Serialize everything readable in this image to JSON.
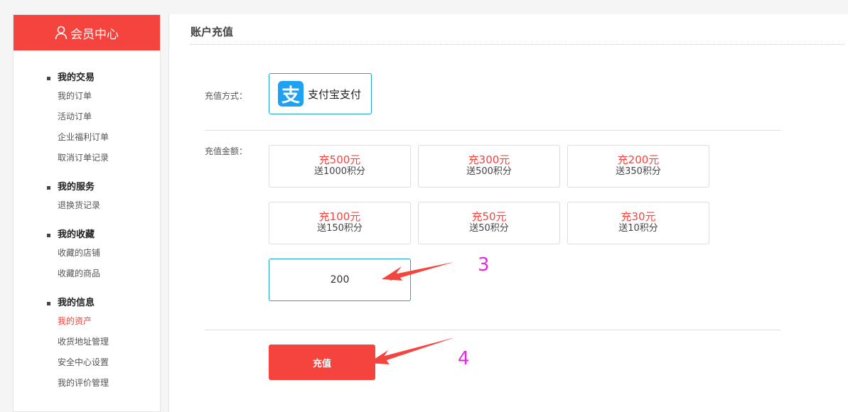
{
  "sidebar": {
    "title": "会员中心",
    "groups": [
      {
        "title": "我的交易",
        "items": [
          "我的订单",
          "活动订单",
          "企业福利订单",
          "取消订单记录"
        ]
      },
      {
        "title": "我的服务",
        "items": [
          "退换货记录"
        ]
      },
      {
        "title": "我的收藏",
        "items": [
          "收藏的店铺",
          "收藏的商品"
        ]
      },
      {
        "title": "我的信息",
        "items": [
          "我的资产",
          "收货地址管理",
          "安全中心设置",
          "我的评价管理"
        ]
      }
    ]
  },
  "main": {
    "title": "账户充值",
    "pay_method_label": "充值方式：",
    "pay_option": "支付宝支付",
    "amount_label": "充值金额：",
    "options": [
      {
        "amount": "充500元",
        "bonus": "送1000积分"
      },
      {
        "amount": "充300元",
        "bonus": "送500积分"
      },
      {
        "amount": "充200元",
        "bonus": "送350积分"
      },
      {
        "amount": "充100元",
        "bonus": "送150积分"
      },
      {
        "amount": "充50元",
        "bonus": "送50积分"
      },
      {
        "amount": "充30元",
        "bonus": "送10积分"
      }
    ],
    "custom_amount": "200",
    "submit_label": "充值"
  },
  "annotations": {
    "step3": "3",
    "step4": "4"
  },
  "colors": {
    "accent": "#f5443e",
    "focus_border": "#1aa6c9",
    "annotation": "#e02be0"
  }
}
